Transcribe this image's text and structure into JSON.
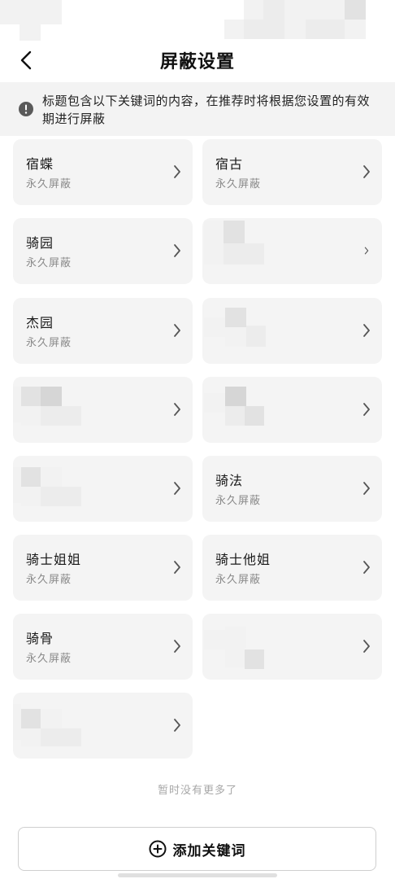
{
  "header": {
    "title": "屏蔽设置",
    "back_icon": "chevron-left-icon"
  },
  "notice": {
    "icon": "alert-circle-icon",
    "text": "标题包含以下关键词的内容，在推荐时将根据您设置的有效期进行屏蔽"
  },
  "keywords": [
    {
      "word": "宿蝶",
      "duration": "永久屏蔽",
      "hidden": false
    },
    {
      "word": "宿古",
      "duration": "永久屏蔽",
      "hidden": false
    },
    {
      "word": "骑园",
      "duration": "永久屏蔽",
      "hidden": false
    },
    {
      "word": "",
      "duration": "",
      "hidden": true
    },
    {
      "word": "杰园",
      "duration": "永久屏蔽",
      "hidden": false
    },
    {
      "word": "",
      "duration": "",
      "hidden": true
    },
    {
      "word": "",
      "duration": "",
      "hidden": true
    },
    {
      "word": "",
      "duration": "",
      "hidden": true
    },
    {
      "word": "",
      "duration": "",
      "hidden": true
    },
    {
      "word": "骑法",
      "duration": "永久屏蔽",
      "hidden": false
    },
    {
      "word": "骑士姐姐",
      "duration": "永久屏蔽",
      "hidden": false
    },
    {
      "word": "骑士他姐",
      "duration": "永久屏蔽",
      "hidden": false
    },
    {
      "word": "骑骨",
      "duration": "永久屏蔽",
      "hidden": false
    },
    {
      "word": "",
      "duration": "",
      "hidden": true
    },
    {
      "word": "",
      "duration": "",
      "hidden": true
    }
  ],
  "footer": {
    "no_more": "暂时没有更多了"
  },
  "add_button": {
    "label": "添加关键词",
    "icon": "plus-circle-icon"
  },
  "colors": {
    "card_bg": "#f4f4f4",
    "notice_bg": "#f3f3f3",
    "sub_text": "#8a8a8a"
  }
}
